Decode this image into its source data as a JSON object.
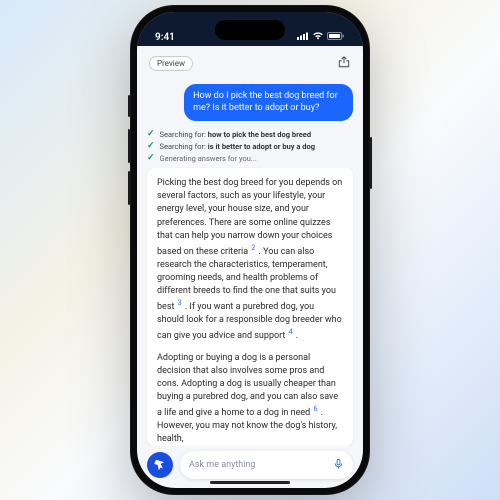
{
  "statusbar": {
    "time": "9:41"
  },
  "topbar": {
    "preview_label": "Preview"
  },
  "user_message": "How do I pick the best dog breed for me? Is it better to adopt or buy?",
  "status": {
    "prefix": "Searching for:",
    "q1": "how to pick the best dog breed",
    "q2": "is it better to adopt or buy a dog",
    "gen": "Generating answers for you..."
  },
  "answer": {
    "p1a": "Picking the best dog breed for you depends on several factors, such as your lifestyle, your energy level, your house size, and your preferences. There are some online quizzes that can help you narrow down your choices based on these criteria",
    "s1": "2",
    "p1b": ". You can also research the characteristics, temperament, grooming needs, and health problems of different breeds to find the one that suits you best",
    "s2": "3",
    "p1c": ". If you want a purebred dog, you should look for a responsible dog breeder who can give you advice and support",
    "s3": "4",
    "p1d": ".",
    "p2a": "Adopting or buying a dog is a personal decision that also involves some pros and cons. Adopting a dog is usually cheaper than buying a purebred dog, and you can also save a life and give a home to a dog in need",
    "s4": "6",
    "p2b": ". However, you may not know the dog's history, health,"
  },
  "input": {
    "placeholder": "Ask me anything"
  }
}
